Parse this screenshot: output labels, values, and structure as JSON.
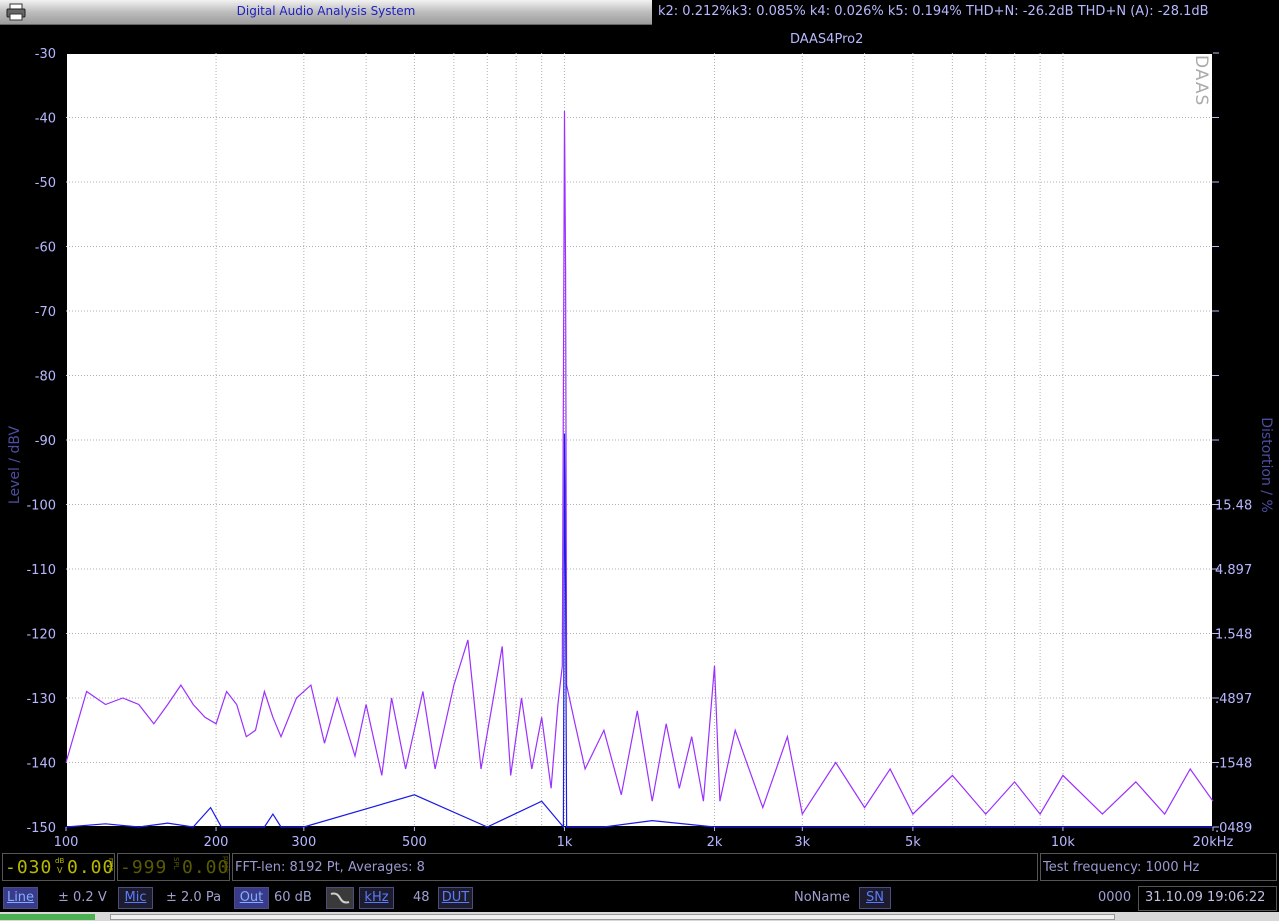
{
  "window": {
    "title": "Digital Audio Analysis System",
    "distortion_readout": "k2: 0.212%k3: 0.085% k4: 0.026% k5: 0.194% THD+N: -26.2dB THD+N (A): -28.1dB"
  },
  "chart_data": {
    "type": "line",
    "title": "DAAS4Pro2",
    "watermark": "DAAS",
    "ylabel": "Level / dBV",
    "y2label": "Distortion / %",
    "xscale": "log",
    "xlim": [
      100,
      20000
    ],
    "ylim": [
      -150,
      -30
    ],
    "x_ticks": [
      100,
      200,
      300,
      500,
      1000,
      2000,
      3000,
      5000,
      10000,
      20000
    ],
    "x_tick_labels": [
      "100",
      "200",
      "300",
      "500",
      "1k",
      "2k",
      "3k",
      "5k",
      "10k",
      "20kHz"
    ],
    "y_ticks": [
      -30,
      -40,
      -50,
      -60,
      -70,
      -80,
      -90,
      -100,
      -110,
      -120,
      -130,
      -140,
      -150
    ],
    "y_tick_labels": [
      "-30",
      "-40",
      "-50",
      "-60",
      "-70",
      "-80",
      "-90",
      "-100",
      "-110",
      "-120",
      "-130",
      "-140",
      "-150"
    ],
    "y2_ticks": [
      {
        "level": -100,
        "label": "15.48"
      },
      {
        "level": -110,
        "label": "4.897"
      },
      {
        "level": -120,
        "label": "1.548"
      },
      {
        "level": -130,
        "label": ".4897"
      },
      {
        "level": -140,
        "label": ".1548"
      },
      {
        "level": -150,
        "label": ".0489"
      }
    ],
    "grid": true,
    "series": [
      {
        "color": "#9b30ff",
        "points": [
          [
            100,
            -140
          ],
          [
            110,
            -129
          ],
          [
            120,
            -131
          ],
          [
            130,
            -130
          ],
          [
            140,
            -131
          ],
          [
            150,
            -134
          ],
          [
            160,
            -131
          ],
          [
            170,
            -128
          ],
          [
            180,
            -131
          ],
          [
            190,
            -133
          ],
          [
            200,
            -134
          ],
          [
            210,
            -129
          ],
          [
            220,
            -131
          ],
          [
            230,
            -136
          ],
          [
            240,
            -135
          ],
          [
            250,
            -129
          ],
          [
            260,
            -133
          ],
          [
            270,
            -136
          ],
          [
            290,
            -130
          ],
          [
            310,
            -128
          ],
          [
            330,
            -137
          ],
          [
            350,
            -130
          ],
          [
            380,
            -139
          ],
          [
            400,
            -131
          ],
          [
            430,
            -142
          ],
          [
            450,
            -130
          ],
          [
            480,
            -141
          ],
          [
            520,
            -129
          ],
          [
            550,
            -141
          ],
          [
            600,
            -128
          ],
          [
            640,
            -121
          ],
          [
            680,
            -141
          ],
          [
            720,
            -130
          ],
          [
            750,
            -122
          ],
          [
            780,
            -142
          ],
          [
            820,
            -130
          ],
          [
            860,
            -141
          ],
          [
            900,
            -133
          ],
          [
            940,
            -144
          ],
          [
            970,
            -131
          ],
          [
            990,
            -125
          ],
          [
            1000,
            -39
          ],
          [
            1005,
            -64
          ],
          [
            1010,
            -128
          ],
          [
            1050,
            -134
          ],
          [
            1100,
            -141
          ],
          [
            1200,
            -135
          ],
          [
            1300,
            -145
          ],
          [
            1400,
            -132
          ],
          [
            1500,
            -146
          ],
          [
            1600,
            -134
          ],
          [
            1700,
            -144
          ],
          [
            1800,
            -136
          ],
          [
            1900,
            -146
          ],
          [
            2000,
            -125
          ],
          [
            2050,
            -146
          ],
          [
            2200,
            -135
          ],
          [
            2500,
            -147
          ],
          [
            2800,
            -136
          ],
          [
            3000,
            -148
          ],
          [
            3500,
            -140
          ],
          [
            4000,
            -147
          ],
          [
            4500,
            -141
          ],
          [
            5000,
            -148
          ],
          [
            6000,
            -142
          ],
          [
            7000,
            -148
          ],
          [
            8000,
            -143
          ],
          [
            9000,
            -148
          ],
          [
            10000,
            -142
          ],
          [
            12000,
            -148
          ],
          [
            14000,
            -143
          ],
          [
            16000,
            -148
          ],
          [
            18000,
            -141
          ],
          [
            20000,
            -146
          ]
        ]
      },
      {
        "color": "#1a1ae6",
        "points": [
          [
            100,
            -150
          ],
          [
            120,
            -149.5
          ],
          [
            140,
            -150
          ],
          [
            160,
            -149.4
          ],
          [
            180,
            -150
          ],
          [
            195,
            -147
          ],
          [
            205,
            -150
          ],
          [
            250,
            -150
          ],
          [
            260,
            -148
          ],
          [
            270,
            -150
          ],
          [
            300,
            -150
          ],
          [
            500,
            -145
          ],
          [
            700,
            -150
          ],
          [
            900,
            -146
          ],
          [
            995,
            -150
          ],
          [
            1000,
            -89
          ],
          [
            1005,
            -113
          ],
          [
            1010,
            -150
          ],
          [
            1200,
            -150
          ],
          [
            1500,
            -149
          ],
          [
            2000,
            -150
          ],
          [
            3000,
            -150
          ],
          [
            20000,
            -150
          ]
        ]
      }
    ]
  },
  "status": {
    "lcd_level": "-030",
    "lcd_level_unit_top": "dB",
    "lcd_level_unit_bottom": "V",
    "lcd_rms": "0.00",
    "lcd_rms_unit": "rms",
    "lcd_spl": "-999",
    "lcd_spl_unit": "SPL",
    "lcd_peak": "0.00",
    "lcd_peak_unit": "peak",
    "fft_info": "FFT-len: 8192 Pt, Averages: 8",
    "test_frequency": "Test frequency: 1000 Hz"
  },
  "toolbar": {
    "line_label": "Line",
    "line_range": "± 0.2 V",
    "mic_label": "Mic",
    "mic_range": "± 2.0 Pa",
    "out_label": "Out",
    "out_value": "60 dB",
    "khz_label": "kHz",
    "khz_value": "48",
    "dut_label": "DUT",
    "noname": "NoName",
    "sn_label": "SN",
    "sn_value": "0000",
    "datetime": "31.10.09 19:06:22"
  },
  "colors": {
    "spectrum": "#9b30ff",
    "noise_floor": "#1a1ae6",
    "plot_background": "#ffffff",
    "grid": "#9a9a9a",
    "frame": "#000000"
  }
}
